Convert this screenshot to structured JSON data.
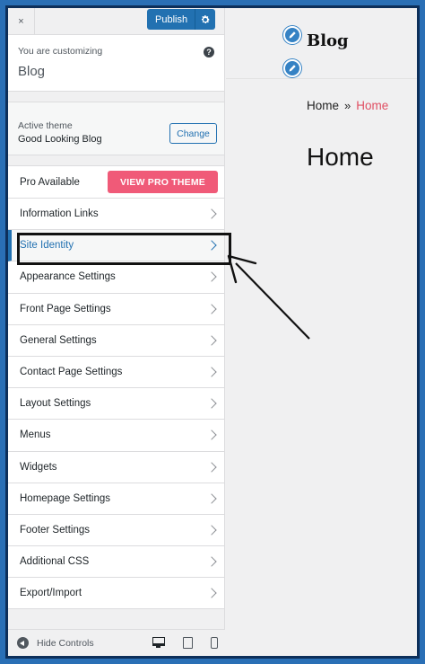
{
  "topbar": {
    "close_label": "×",
    "publish_label": "Publish"
  },
  "customizing": {
    "prefix": "You are customizing",
    "site": "Blog",
    "help": "?"
  },
  "theme": {
    "prefix": "Active theme",
    "name": "Good Looking Blog",
    "change_label": "Change"
  },
  "pro": {
    "label": "Pro Available",
    "button": "VIEW PRO THEME"
  },
  "sections": [
    {
      "label": "Information Links",
      "active": false
    },
    {
      "label": "Site Identity",
      "active": true
    },
    {
      "label": "Appearance Settings",
      "active": false
    },
    {
      "label": "Front Page Settings",
      "active": false
    },
    {
      "label": "General Settings",
      "active": false
    },
    {
      "label": "Contact Page Settings",
      "active": false
    },
    {
      "label": "Layout Settings",
      "active": false
    },
    {
      "label": "Menus",
      "active": false
    },
    {
      "label": "Widgets",
      "active": false
    },
    {
      "label": "Homepage Settings",
      "active": false
    },
    {
      "label": "Footer Settings",
      "active": false
    },
    {
      "label": "Additional CSS",
      "active": false
    },
    {
      "label": "Export/Import",
      "active": false
    }
  ],
  "footer": {
    "hide_label": "Hide Controls"
  },
  "preview": {
    "site_title": "Blog",
    "breadcrumb_home": "Home",
    "breadcrumb_sep": "»",
    "breadcrumb_current": "Home",
    "page_title": "Home"
  },
  "colors": {
    "accent": "#2271b1",
    "pro": "#f05a78",
    "breadcrumb_current": "#e04f63"
  }
}
